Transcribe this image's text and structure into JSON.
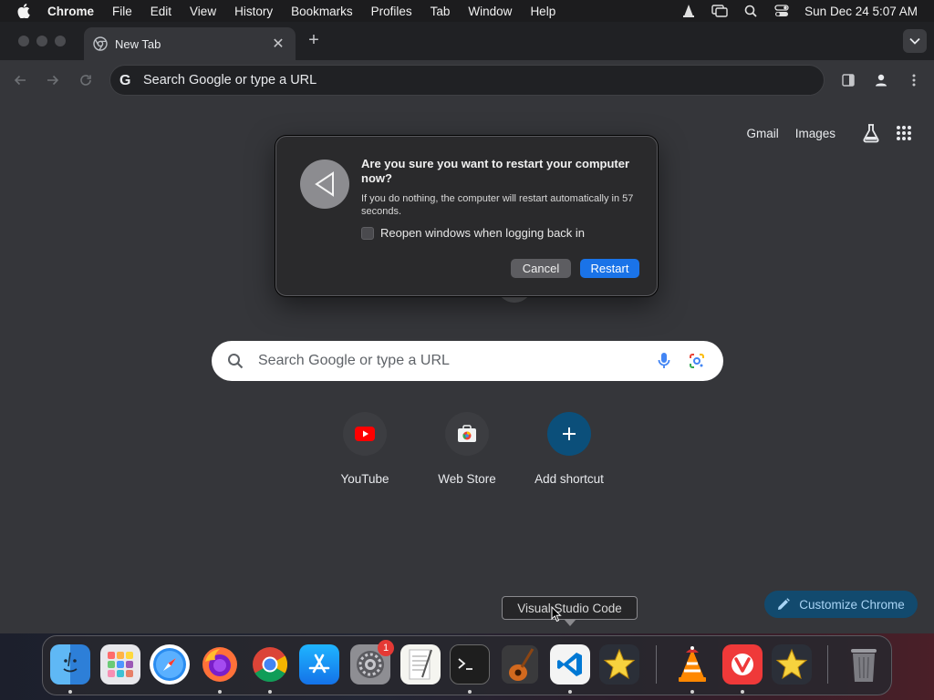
{
  "menubar": {
    "app_name": "Chrome",
    "items": [
      "File",
      "Edit",
      "View",
      "History",
      "Bookmarks",
      "Profiles",
      "Tab",
      "Window",
      "Help"
    ],
    "clock": "Sun Dec 24  5:07 AM",
    "status_icons": [
      "vlc-icon",
      "screen-mirror-icon",
      "spotlight-search-icon",
      "control-center-icon"
    ]
  },
  "tab": {
    "title": "New Tab"
  },
  "toolbar": {
    "omnibox_placeholder": "Search Google or type a URL"
  },
  "ntp": {
    "links": {
      "gmail": "Gmail",
      "images": "Images"
    },
    "search_placeholder": "Search Google or type a URL",
    "shortcuts": [
      {
        "label": "YouTube",
        "icon": "youtube-icon"
      },
      {
        "label": "Web Store",
        "icon": "web-store-icon"
      },
      {
        "label": "Add shortcut",
        "icon": "plus-icon"
      }
    ],
    "customize_label": "Customize Chrome"
  },
  "dialog": {
    "title": "Are you sure you want to restart your computer now?",
    "message": "If you do nothing, the computer will restart automatically in 57 seconds.",
    "checkbox_label": "Reopen windows when logging back in",
    "checkbox_checked": false,
    "cancel_label": "Cancel",
    "restart_label": "Restart"
  },
  "tooltip": {
    "text": "Visual Studio Code"
  },
  "dock": {
    "apps": [
      "Finder",
      "Launchpad",
      "Safari",
      "Firefox",
      "Google Chrome",
      "App Store",
      "System Settings",
      "TextEdit",
      "Terminal",
      "GarageBand",
      "Visual Studio Code",
      "Stellarium",
      "VLC",
      "Vivaldi",
      "Stellarium",
      "Trash"
    ],
    "settings_badge": "1"
  },
  "colors": {
    "accent_blue": "#1a73e8",
    "window_bg": "#35363a",
    "customize_bg": "#124a6e"
  }
}
